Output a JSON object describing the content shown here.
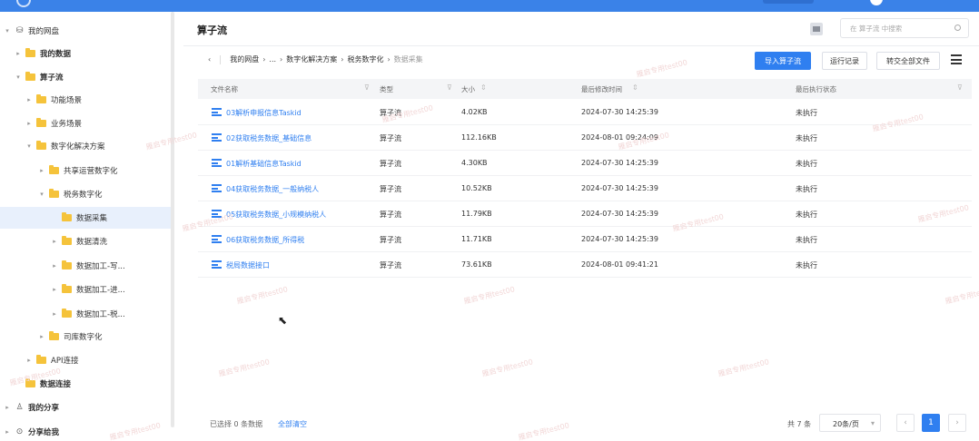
{
  "sidebar": {
    "items": [
      {
        "label": "我的网盘",
        "level": 0,
        "caret": "▾",
        "icon": "drive-icon",
        "bold": false
      },
      {
        "label": "我的数据",
        "level": 1,
        "caret": "▸",
        "icon": "folder-icon",
        "bold": true
      },
      {
        "label": "算子流",
        "level": 1,
        "caret": "▾",
        "icon": "folder-icon",
        "bold": true
      },
      {
        "label": "功能场景",
        "level": 2,
        "caret": "▸",
        "icon": "folder-icon",
        "bold": false
      },
      {
        "label": "业务场景",
        "level": 2,
        "caret": "▸",
        "icon": "folder-icon",
        "bold": false
      },
      {
        "label": "数字化解决方案",
        "level": 2,
        "caret": "▾",
        "icon": "folder-icon",
        "bold": false
      },
      {
        "label": "共享运营数字化",
        "level": 3,
        "caret": "▸",
        "icon": "folder-icon",
        "bold": false
      },
      {
        "label": "税务数字化",
        "level": 3,
        "caret": "▾",
        "icon": "folder-icon",
        "bold": false
      },
      {
        "label": "数据采集",
        "level": 4,
        "caret": "",
        "icon": "folder-icon",
        "bold": false,
        "selected": true
      },
      {
        "label": "数据清洗",
        "level": 4,
        "caret": "▸",
        "icon": "folder-icon",
        "bold": false
      },
      {
        "label": "数据加工-写...",
        "level": 4,
        "caret": "▸",
        "icon": "folder-icon",
        "bold": false
      },
      {
        "label": "数据加工-进...",
        "level": 4,
        "caret": "▸",
        "icon": "folder-icon",
        "bold": false
      },
      {
        "label": "数据加工-税...",
        "level": 4,
        "caret": "▸",
        "icon": "folder-icon",
        "bold": false
      },
      {
        "label": "司库数字化",
        "level": 3,
        "caret": "▸",
        "icon": "folder-icon",
        "bold": false
      },
      {
        "label": "API连接",
        "level": 2,
        "caret": "▸",
        "icon": "folder-icon",
        "bold": false
      },
      {
        "label": "数据连接",
        "level": 1,
        "caret": "",
        "icon": "folder-icon",
        "bold": true
      },
      {
        "label": "我的分享",
        "level": 0,
        "caret": "▸",
        "icon": "share-icon",
        "bold": true
      },
      {
        "label": "分享给我",
        "level": 0,
        "caret": "▸",
        "icon": "shared-with-me-icon",
        "bold": true
      }
    ]
  },
  "header": {
    "title": "算子流",
    "search_placeholder": "在 算子流 中搜索"
  },
  "breadcrumb": {
    "back": "‹",
    "items": [
      "我的网盘",
      "...",
      "数字化解决方案",
      "税务数字化"
    ],
    "current": "数据采集"
  },
  "toolbar": {
    "import_label": "导入算子流",
    "run_log_label": "运行记录",
    "convert_all_label": "转交全部文件"
  },
  "table": {
    "columns": [
      "文件名称",
      "类型",
      "大小",
      "最后修改时间",
      "最后执行状态"
    ],
    "rows": [
      {
        "name": "03解析申报信息Taskid",
        "type": "算子流",
        "size": "4.02KB",
        "modified": "2024-07-30 14:25:39",
        "status": "未执行"
      },
      {
        "name": "02获取税务数据_基础信息",
        "type": "算子流",
        "size": "112.16KB",
        "modified": "2024-08-01 09:24:09",
        "status": "未执行"
      },
      {
        "name": "01解析基础信息Taskid",
        "type": "算子流",
        "size": "4.30KB",
        "modified": "2024-07-30 14:25:39",
        "status": "未执行"
      },
      {
        "name": "04获取税务数据_一般纳税人",
        "type": "算子流",
        "size": "10.52KB",
        "modified": "2024-07-30 14:25:39",
        "status": "未执行"
      },
      {
        "name": "05获取税务数据_小规模纳税人",
        "type": "算子流",
        "size": "11.79KB",
        "modified": "2024-07-30 14:25:39",
        "status": "未执行"
      },
      {
        "name": "06获取税务数据_所得税",
        "type": "算子流",
        "size": "11.71KB",
        "modified": "2024-07-30 14:25:39",
        "status": "未执行"
      },
      {
        "name": "税局数据接口",
        "type": "算子流",
        "size": "73.61KB",
        "modified": "2024-08-01 09:41:21",
        "status": "未执行"
      }
    ]
  },
  "footer": {
    "selected_text": "已选择 0 条数据",
    "clear_label": "全部清空",
    "total_text": "共 7 条",
    "page_size": "20条/页",
    "prev": "‹",
    "current_page": "1",
    "next": "›"
  },
  "watermark_text": "雁启专用test00",
  "colors": {
    "accent": "#2f7ff0",
    "topbar": "#3a82e8",
    "folder": "#f5c33b",
    "selected_row": "#e8f0fc"
  }
}
